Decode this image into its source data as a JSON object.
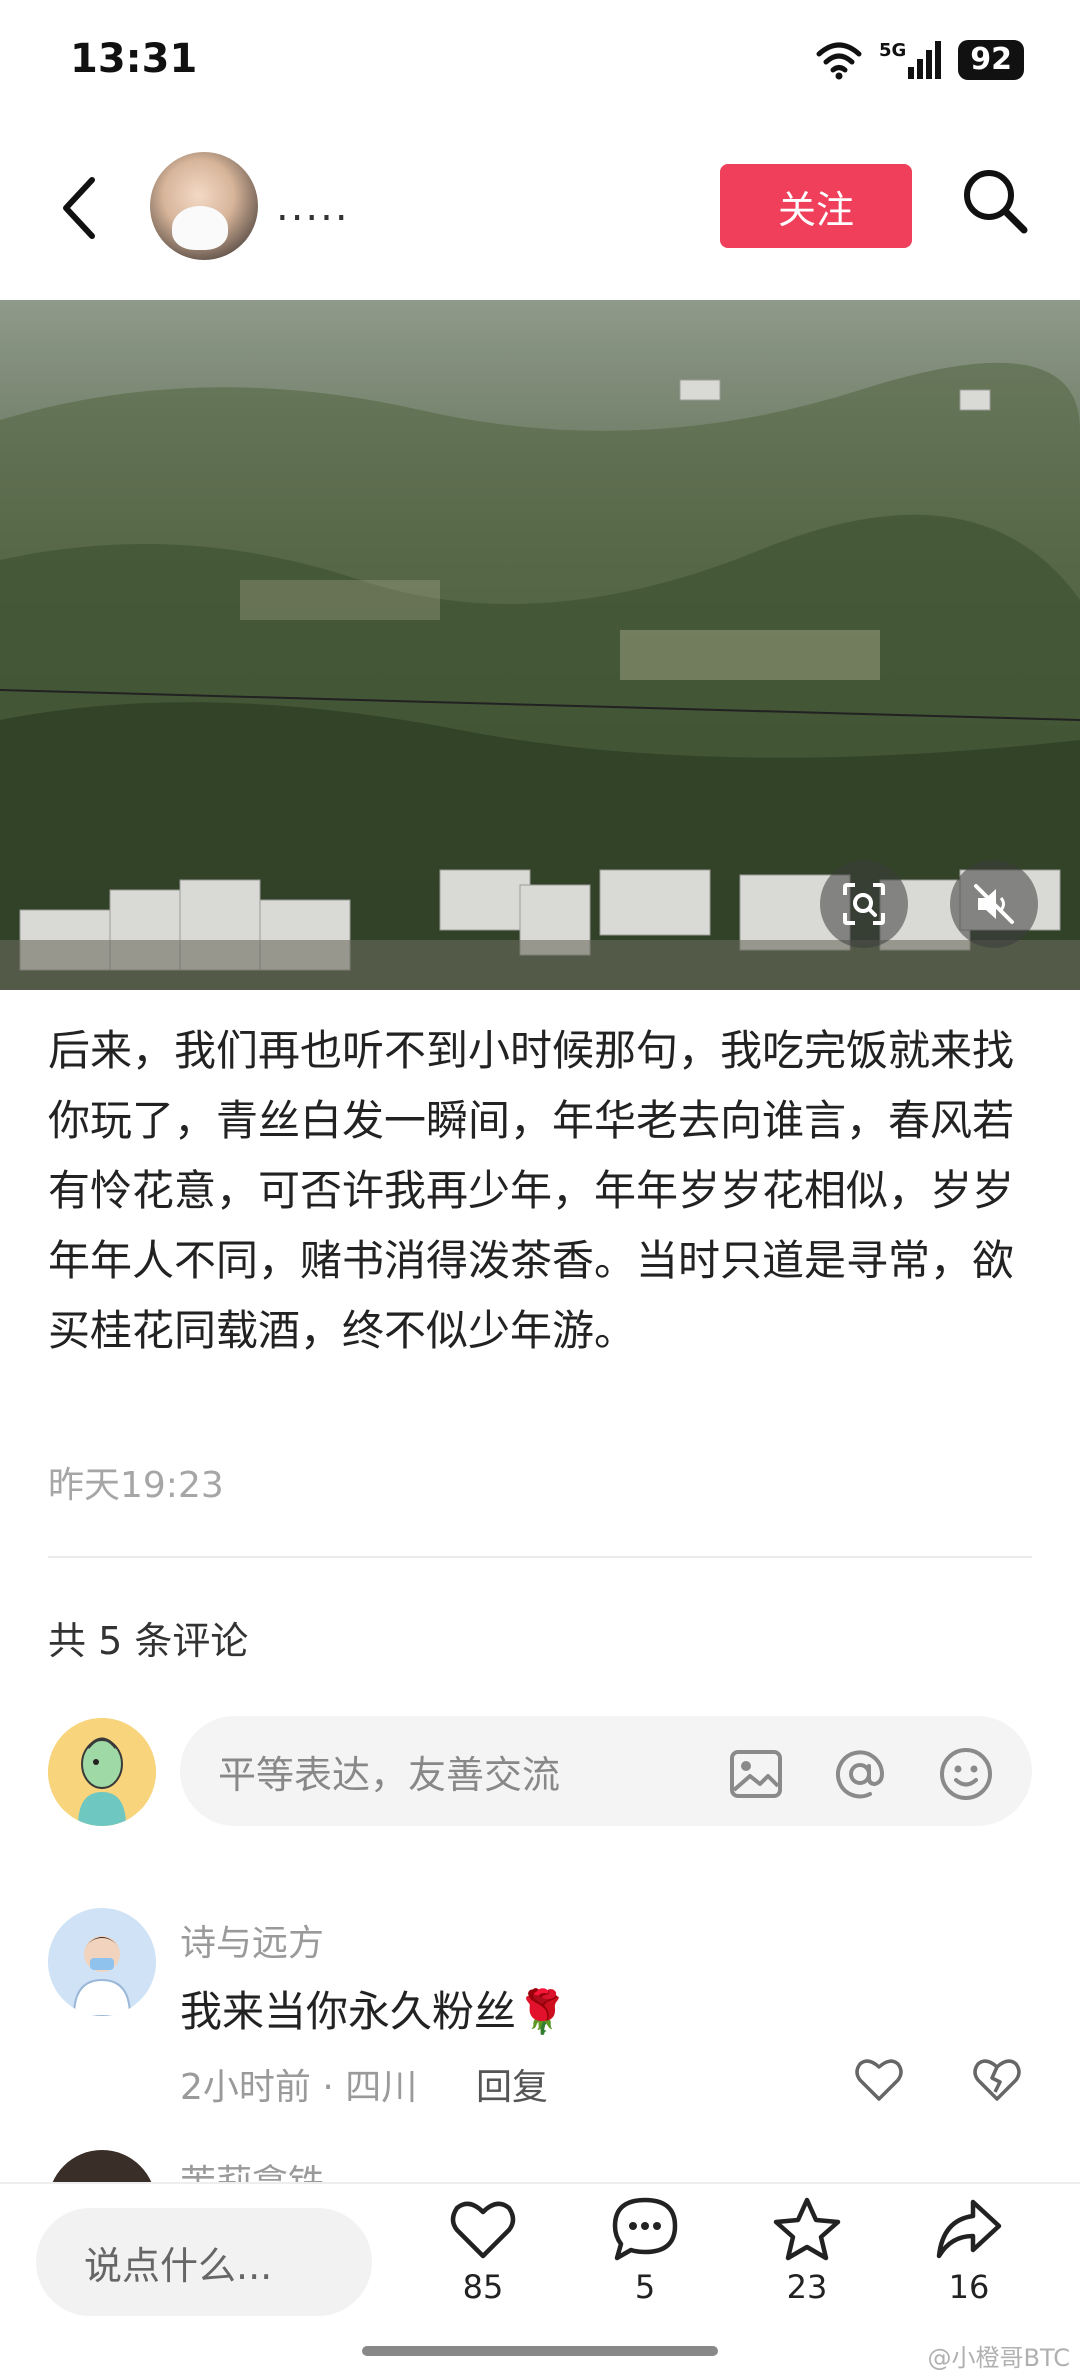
{
  "status_bar": {
    "time": "13:31",
    "network": "5G",
    "battery": "92"
  },
  "header": {
    "username": ".....",
    "follow_label": "关注"
  },
  "post": {
    "body": "后来，我们再也听不到小时候那句，我吃完饭就来找你玩了，青丝白发一瞬间，年华老去向谁言，春风若有怜花意，可否许我再少年，年年岁岁花相似，岁岁年年人不同，赌书消得泼茶香。当时只道是寻常，欲买桂花同载酒，终不似少年游。",
    "time": "昨天19:23"
  },
  "comments": {
    "count_label": "共 5 条评论",
    "input_placeholder": "平等表达，友善交流",
    "items": [
      {
        "name": "诗与远方",
        "text": "我来当你永久粉丝🌹",
        "meta": "2小时前 · 四川",
        "reply_label": "回复"
      },
      {
        "name": "茉莉拿铁"
      }
    ]
  },
  "bottom_bar": {
    "input_placeholder": "说点什么...",
    "likes": "85",
    "comments": "5",
    "favorites": "23",
    "shares": "16"
  },
  "watermark": "@小橙哥BTC",
  "colors": {
    "accent": "#ef3f5a"
  }
}
